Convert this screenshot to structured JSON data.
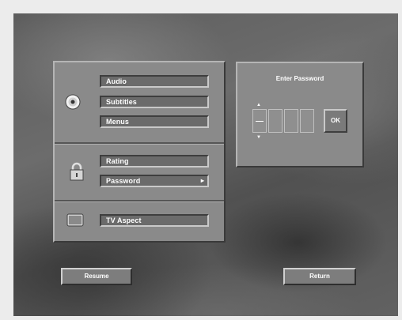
{
  "menu": {
    "language_items": [
      "Audio",
      "Subtitles",
      "Menus"
    ],
    "rating_items": [
      "Rating",
      "Password"
    ],
    "display_items": [
      "TV Aspect"
    ],
    "submenu_arrow": "▸"
  },
  "password_box": {
    "title": "Enter Password",
    "ok_label": "OK",
    "up_arrow": "▲",
    "down_arrow": "▼"
  },
  "footer": {
    "resume_label": "Resume",
    "return_label": "Return"
  },
  "icons": [
    "disc-icon",
    "lock-icon",
    "tv-icon"
  ]
}
